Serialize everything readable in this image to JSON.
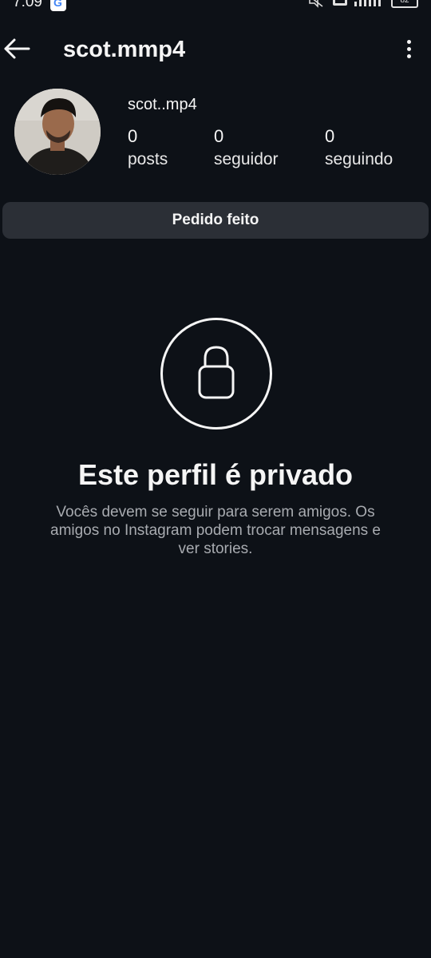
{
  "status_bar": {
    "time": "7:09",
    "battery": "82",
    "icons": [
      "google-icon",
      "muted-icon",
      "volte-icon",
      "signal-icon",
      "battery-icon"
    ]
  },
  "header": {
    "title": "scot.mmp4",
    "icons": [
      "back-arrow-icon",
      "more-vertical-icon"
    ]
  },
  "profile": {
    "name": "scot..mp4",
    "stats": [
      {
        "count": "0",
        "label": "posts"
      },
      {
        "count": "0",
        "label": "seguidor"
      },
      {
        "count": "0",
        "label": "seguindo"
      }
    ]
  },
  "request_button": {
    "label": "Pedido feito"
  },
  "private_notice": {
    "icon": "lock-icon",
    "title": "Este perfil é privado",
    "description": "Vocês devem se seguir para serem amigos. Os amigos no Instagram podem trocar mensagens e ver stories."
  },
  "colors": {
    "background": "#0d1117",
    "button": "#2b2f36",
    "text": "#f5f5f5",
    "muted_text": "#a8abb0"
  }
}
